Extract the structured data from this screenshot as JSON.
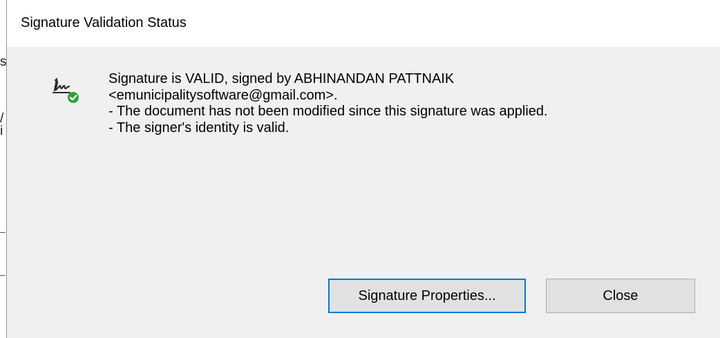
{
  "dialog": {
    "title": "Signature Validation Status",
    "icon": "signature-valid-icon",
    "message_lines": [
      "Signature is VALID, signed by ABHINANDAN PATTNAIK",
      "<emunicipalitysoftware@gmail.com>.",
      "- The document has not been modified since this signature was applied.",
      "- The signer's identity is valid."
    ],
    "buttons": {
      "properties_label": "Signature Properties...",
      "close_label": "Close"
    }
  },
  "background_fragments": [
    "s",
    "/",
    "i"
  ],
  "colors": {
    "dialog_bg": "#f0f0f0",
    "titlebar_bg": "#ffffff",
    "button_bg": "#e1e1e1",
    "button_border": "#adadad",
    "focus_border": "#0078d7",
    "check_green": "#2fa233"
  }
}
